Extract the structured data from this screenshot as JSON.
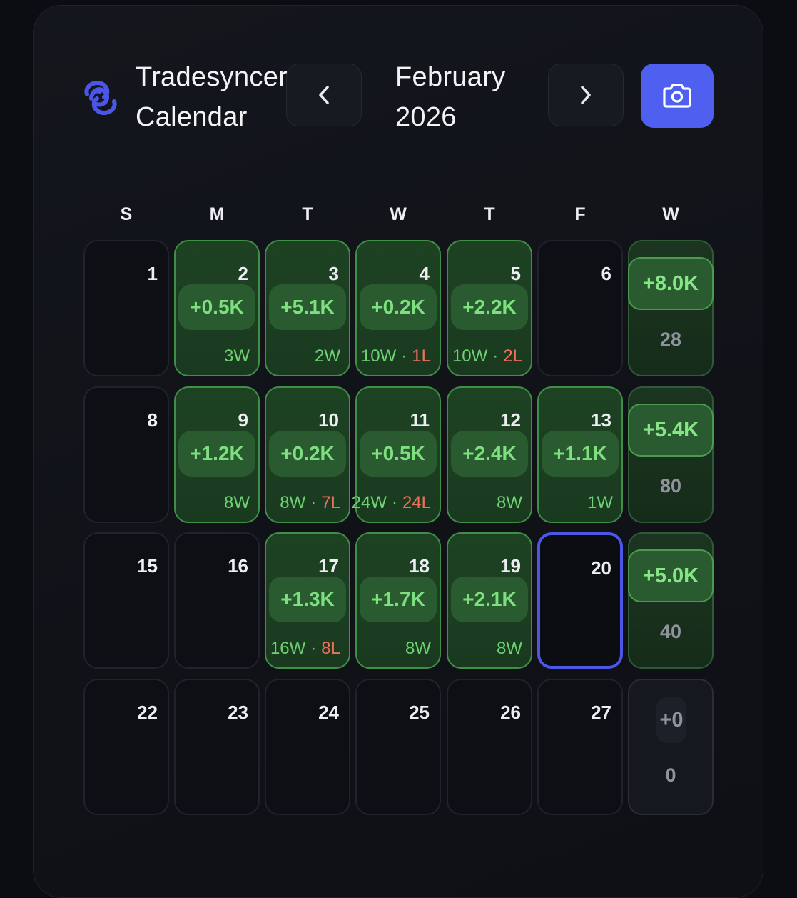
{
  "header": {
    "brand_line1": "Tradesyncer",
    "brand_line2": "Calendar",
    "month_line1": "February",
    "month_line2": "2026",
    "logo_icon": "tradesyncer-logo-icon",
    "prev_icon": "chevron-left-icon",
    "next_icon": "chevron-right-icon",
    "camera_icon": "camera-icon",
    "accent_color": "#4f5ff0"
  },
  "weekdays": [
    "S",
    "M",
    "T",
    "W",
    "T",
    "F",
    "W"
  ],
  "weeks": [
    {
      "days": [
        {
          "day": "1",
          "pnl": null,
          "wins": null,
          "losses": null
        },
        {
          "day": "2",
          "pnl": "+0.5K",
          "wins": "3W",
          "losses": null
        },
        {
          "day": "3",
          "pnl": "+5.1K",
          "wins": "2W",
          "losses": null
        },
        {
          "day": "4",
          "pnl": "+0.2K",
          "wins": "10W",
          "losses": "1L"
        },
        {
          "day": "5",
          "pnl": "+2.2K",
          "wins": "10W",
          "losses": "2L"
        },
        {
          "day": "6",
          "pnl": null,
          "wins": null,
          "losses": null
        }
      ],
      "summary": {
        "pnl": "+8.0K",
        "trades": "28"
      }
    },
    {
      "days": [
        {
          "day": "8",
          "pnl": null,
          "wins": null,
          "losses": null
        },
        {
          "day": "9",
          "pnl": "+1.2K",
          "wins": "8W",
          "losses": null
        },
        {
          "day": "10",
          "pnl": "+0.2K",
          "wins": "8W",
          "losses": "7L"
        },
        {
          "day": "11",
          "pnl": "+0.5K",
          "wins": "24W",
          "losses": "24L"
        },
        {
          "day": "12",
          "pnl": "+2.4K",
          "wins": "8W",
          "losses": null
        },
        {
          "day": "13",
          "pnl": "+1.1K",
          "wins": "1W",
          "losses": null
        }
      ],
      "summary": {
        "pnl": "+5.4K",
        "trades": "80"
      }
    },
    {
      "days": [
        {
          "day": "15",
          "pnl": null,
          "wins": null,
          "losses": null
        },
        {
          "day": "16",
          "pnl": null,
          "wins": null,
          "losses": null
        },
        {
          "day": "17",
          "pnl": "+1.3K",
          "wins": "16W",
          "losses": "8L"
        },
        {
          "day": "18",
          "pnl": "+1.7K",
          "wins": "8W",
          "losses": null
        },
        {
          "day": "19",
          "pnl": "+2.1K",
          "wins": "8W",
          "losses": null
        },
        {
          "day": "20",
          "pnl": null,
          "wins": null,
          "losses": null,
          "today": true
        }
      ],
      "summary": {
        "pnl": "+5.0K",
        "trades": "40"
      }
    },
    {
      "days": [
        {
          "day": "22",
          "pnl": null,
          "wins": null,
          "losses": null
        },
        {
          "day": "23",
          "pnl": null,
          "wins": null,
          "losses": null
        },
        {
          "day": "24",
          "pnl": null,
          "wins": null,
          "losses": null
        },
        {
          "day": "25",
          "pnl": null,
          "wins": null,
          "losses": null
        },
        {
          "day": "26",
          "pnl": null,
          "wins": null,
          "losses": null
        },
        {
          "day": "27",
          "pnl": null,
          "wins": null,
          "losses": null
        }
      ],
      "summary": {
        "pnl": "+0",
        "trades": "0",
        "empty": true
      }
    }
  ],
  "separator": "·",
  "colors": {
    "profit_text": "#7ce07e",
    "loss_text": "#f0705c",
    "today_border": "#4b58e6"
  }
}
